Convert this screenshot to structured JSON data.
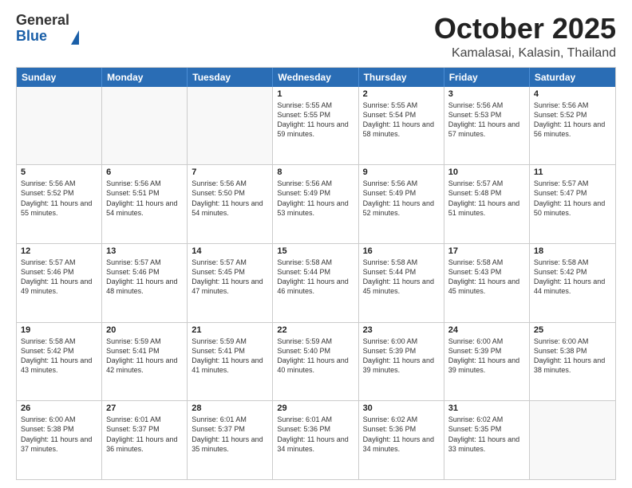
{
  "header": {
    "logo_general": "General",
    "logo_blue": "Blue",
    "month_title": "October 2025",
    "location": "Kamalasai, Kalasin, Thailand"
  },
  "weekdays": [
    "Sunday",
    "Monday",
    "Tuesday",
    "Wednesday",
    "Thursday",
    "Friday",
    "Saturday"
  ],
  "rows": [
    [
      {
        "day": "",
        "empty": true
      },
      {
        "day": "",
        "empty": true
      },
      {
        "day": "",
        "empty": true
      },
      {
        "day": "1",
        "sunrise": "5:55 AM",
        "sunset": "5:55 PM",
        "daylight": "11 hours and 59 minutes."
      },
      {
        "day": "2",
        "sunrise": "5:55 AM",
        "sunset": "5:54 PM",
        "daylight": "11 hours and 58 minutes."
      },
      {
        "day": "3",
        "sunrise": "5:56 AM",
        "sunset": "5:53 PM",
        "daylight": "11 hours and 57 minutes."
      },
      {
        "day": "4",
        "sunrise": "5:56 AM",
        "sunset": "5:52 PM",
        "daylight": "11 hours and 56 minutes."
      }
    ],
    [
      {
        "day": "5",
        "sunrise": "5:56 AM",
        "sunset": "5:52 PM",
        "daylight": "11 hours and 55 minutes."
      },
      {
        "day": "6",
        "sunrise": "5:56 AM",
        "sunset": "5:51 PM",
        "daylight": "11 hours and 54 minutes."
      },
      {
        "day": "7",
        "sunrise": "5:56 AM",
        "sunset": "5:50 PM",
        "daylight": "11 hours and 54 minutes."
      },
      {
        "day": "8",
        "sunrise": "5:56 AM",
        "sunset": "5:49 PM",
        "daylight": "11 hours and 53 minutes."
      },
      {
        "day": "9",
        "sunrise": "5:56 AM",
        "sunset": "5:49 PM",
        "daylight": "11 hours and 52 minutes."
      },
      {
        "day": "10",
        "sunrise": "5:57 AM",
        "sunset": "5:48 PM",
        "daylight": "11 hours and 51 minutes."
      },
      {
        "day": "11",
        "sunrise": "5:57 AM",
        "sunset": "5:47 PM",
        "daylight": "11 hours and 50 minutes."
      }
    ],
    [
      {
        "day": "12",
        "sunrise": "5:57 AM",
        "sunset": "5:46 PM",
        "daylight": "11 hours and 49 minutes."
      },
      {
        "day": "13",
        "sunrise": "5:57 AM",
        "sunset": "5:46 PM",
        "daylight": "11 hours and 48 minutes."
      },
      {
        "day": "14",
        "sunrise": "5:57 AM",
        "sunset": "5:45 PM",
        "daylight": "11 hours and 47 minutes."
      },
      {
        "day": "15",
        "sunrise": "5:58 AM",
        "sunset": "5:44 PM",
        "daylight": "11 hours and 46 minutes."
      },
      {
        "day": "16",
        "sunrise": "5:58 AM",
        "sunset": "5:44 PM",
        "daylight": "11 hours and 45 minutes."
      },
      {
        "day": "17",
        "sunrise": "5:58 AM",
        "sunset": "5:43 PM",
        "daylight": "11 hours and 45 minutes."
      },
      {
        "day": "18",
        "sunrise": "5:58 AM",
        "sunset": "5:42 PM",
        "daylight": "11 hours and 44 minutes."
      }
    ],
    [
      {
        "day": "19",
        "sunrise": "5:58 AM",
        "sunset": "5:42 PM",
        "daylight": "11 hours and 43 minutes."
      },
      {
        "day": "20",
        "sunrise": "5:59 AM",
        "sunset": "5:41 PM",
        "daylight": "11 hours and 42 minutes."
      },
      {
        "day": "21",
        "sunrise": "5:59 AM",
        "sunset": "5:41 PM",
        "daylight": "11 hours and 41 minutes."
      },
      {
        "day": "22",
        "sunrise": "5:59 AM",
        "sunset": "5:40 PM",
        "daylight": "11 hours and 40 minutes."
      },
      {
        "day": "23",
        "sunrise": "6:00 AM",
        "sunset": "5:39 PM",
        "daylight": "11 hours and 39 minutes."
      },
      {
        "day": "24",
        "sunrise": "6:00 AM",
        "sunset": "5:39 PM",
        "daylight": "11 hours and 39 minutes."
      },
      {
        "day": "25",
        "sunrise": "6:00 AM",
        "sunset": "5:38 PM",
        "daylight": "11 hours and 38 minutes."
      }
    ],
    [
      {
        "day": "26",
        "sunrise": "6:00 AM",
        "sunset": "5:38 PM",
        "daylight": "11 hours and 37 minutes."
      },
      {
        "day": "27",
        "sunrise": "6:01 AM",
        "sunset": "5:37 PM",
        "daylight": "11 hours and 36 minutes."
      },
      {
        "day": "28",
        "sunrise": "6:01 AM",
        "sunset": "5:37 PM",
        "daylight": "11 hours and 35 minutes."
      },
      {
        "day": "29",
        "sunrise": "6:01 AM",
        "sunset": "5:36 PM",
        "daylight": "11 hours and 34 minutes."
      },
      {
        "day": "30",
        "sunrise": "6:02 AM",
        "sunset": "5:36 PM",
        "daylight": "11 hours and 34 minutes."
      },
      {
        "day": "31",
        "sunrise": "6:02 AM",
        "sunset": "5:35 PM",
        "daylight": "11 hours and 33 minutes."
      },
      {
        "day": "",
        "empty": true
      }
    ]
  ]
}
